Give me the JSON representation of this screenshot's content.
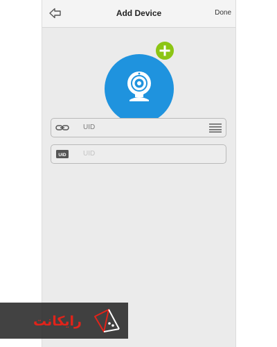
{
  "navbar": {
    "title": "Add Device",
    "done_label": "Done",
    "back_icon": "back-arrow-icon"
  },
  "avatar": {
    "icon": "webcam-icon",
    "badge_icon": "plus-icon",
    "colors": {
      "circle": "#1f93de",
      "badge": "#8cc514"
    }
  },
  "fields": [
    {
      "icon": "link-icon",
      "value": "UID",
      "placeholder": "",
      "trailing_icon": "menu-icon"
    },
    {
      "icon": "uid-badge-icon",
      "icon_text": "UID",
      "value": "",
      "placeholder": "UID"
    }
  ],
  "watermark": {
    "text": "رایکانت",
    "icon": "logo-icon"
  }
}
